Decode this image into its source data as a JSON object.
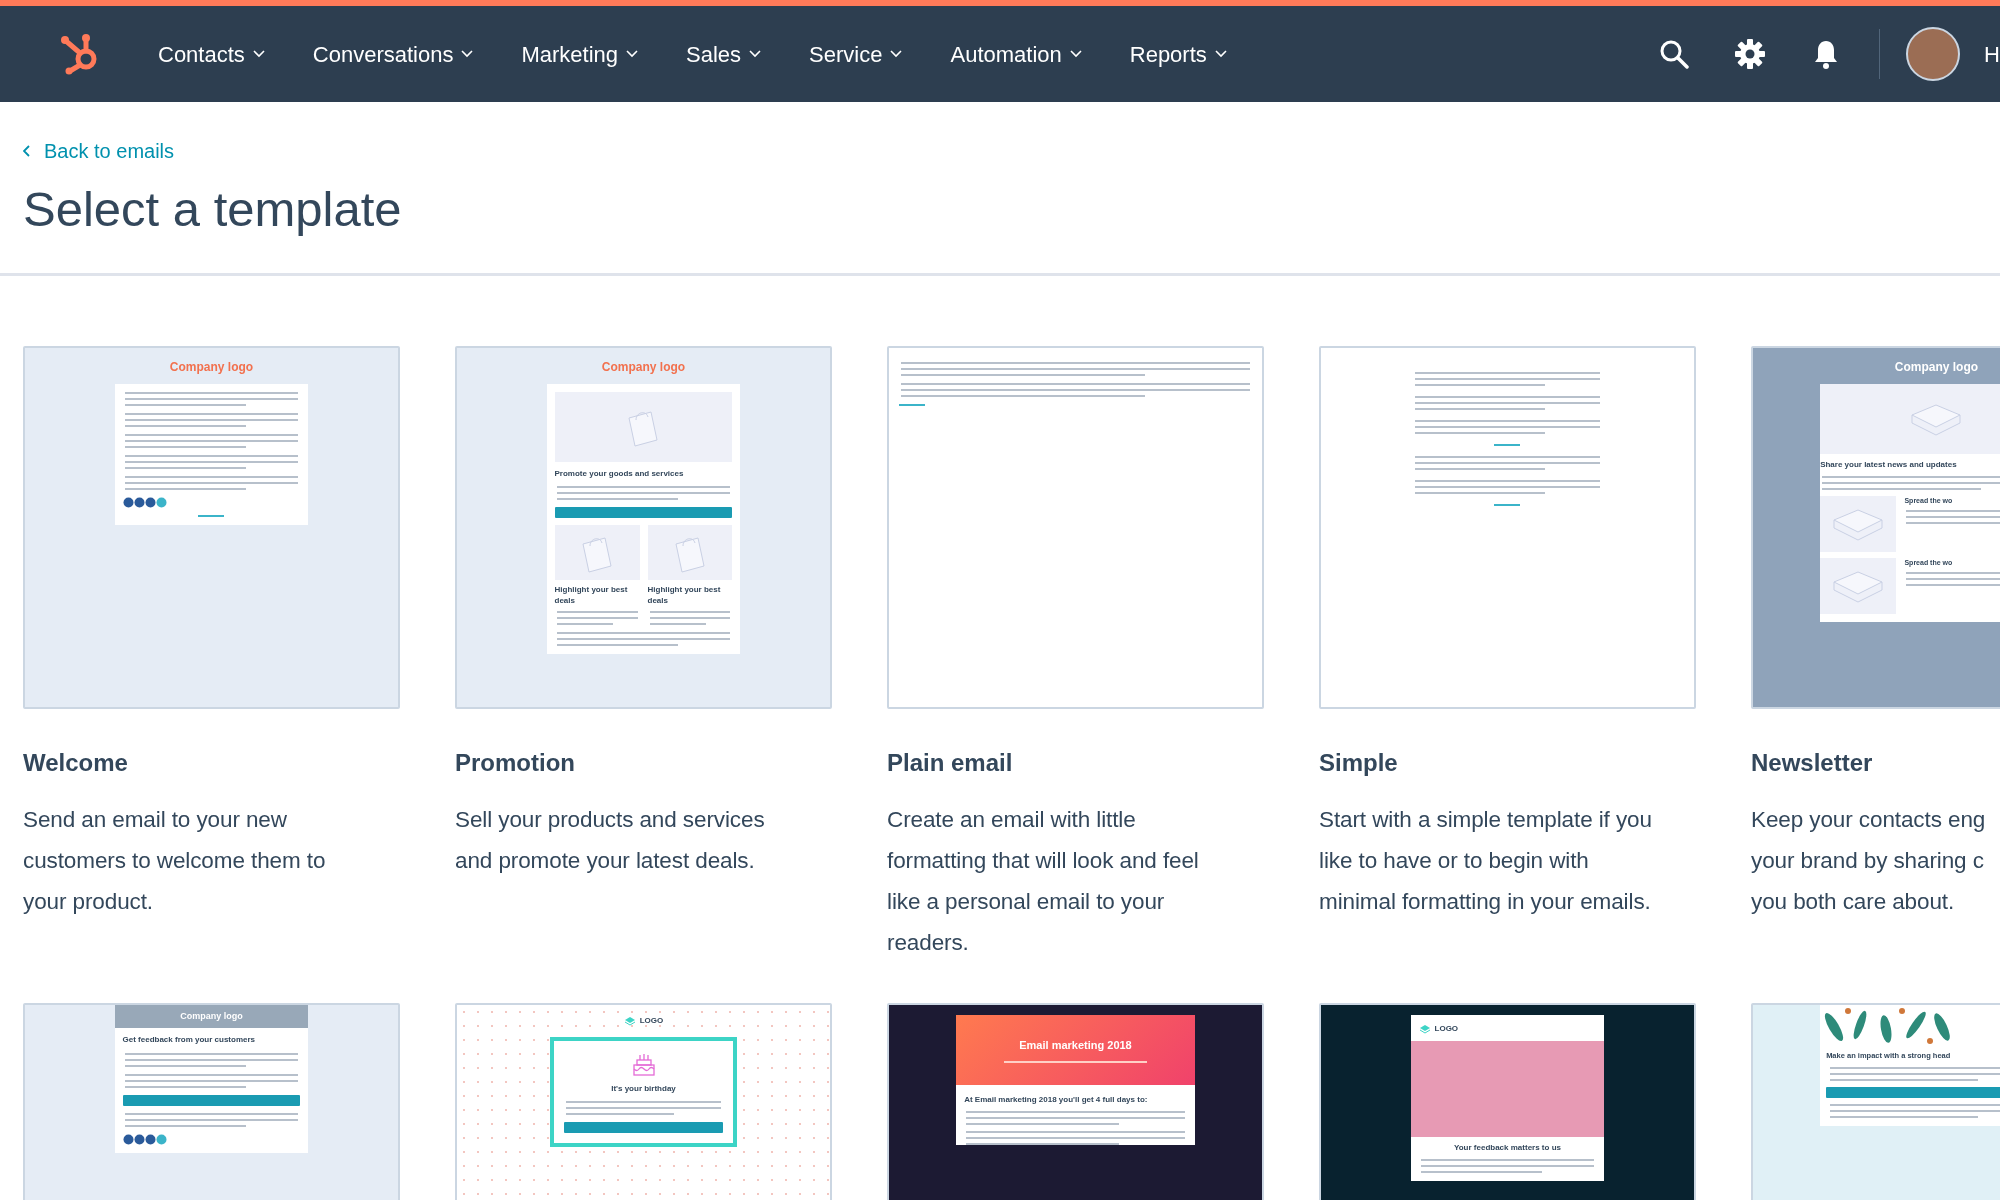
{
  "nav": {
    "items": [
      {
        "label": "Contacts"
      },
      {
        "label": "Conversations"
      },
      {
        "label": "Marketing"
      },
      {
        "label": "Sales"
      },
      {
        "label": "Service"
      },
      {
        "label": "Automation"
      },
      {
        "label": "Reports"
      }
    ],
    "user_name": "H"
  },
  "back_link": "Back to emails",
  "title": "Select a template",
  "templates": [
    {
      "name": "Welcome",
      "description": [
        "Send an email to your new",
        "customers to welcome them to",
        "your product."
      ],
      "preview": {
        "kind": "boxed",
        "logo": {
          "kind": "text",
          "text": "Company logo"
        },
        "blocks": [
          {
            "kind": "lines"
          },
          {
            "kind": "lines"
          },
          {
            "kind": "lines"
          },
          {
            "kind": "lines"
          },
          {
            "kind": "lines"
          },
          {
            "kind": "social"
          },
          {
            "kind": "link"
          }
        ]
      }
    },
    {
      "name": "Promotion",
      "description": [
        "Sell your products and services",
        "and promote your latest deals."
      ],
      "preview": {
        "kind": "boxed",
        "logo": {
          "kind": "text",
          "text": "Company logo"
        },
        "blocks": [
          {
            "kind": "image"
          },
          {
            "kind": "heading",
            "text": "Promote your goods and services"
          },
          {
            "kind": "lines"
          },
          {
            "kind": "cta"
          },
          {
            "kind": "cols",
            "items": [
              {
                "text": "Highlight your best deals"
              },
              {
                "text": "Highlight your best deals"
              }
            ]
          },
          {
            "kind": "lines"
          }
        ]
      }
    },
    {
      "name": "Plain email",
      "description": [
        "Create an email with little",
        "formatting that will look and feel",
        "like a personal email to your",
        "readers."
      ],
      "preview": {
        "kind": "plain",
        "blocks": [
          {
            "kind": "lines"
          },
          {
            "kind": "lines"
          },
          {
            "kind": "link"
          }
        ]
      }
    },
    {
      "name": "Simple",
      "description": [
        "Start with a simple template if you",
        "like to have or to begin with",
        "minimal formatting in your emails."
      ],
      "preview": {
        "kind": "simple",
        "blocks": [
          {
            "kind": "lines"
          },
          {
            "kind": "lines"
          },
          {
            "kind": "lines"
          },
          {
            "kind": "link"
          },
          {
            "kind": "lines"
          },
          {
            "kind": "lines"
          },
          {
            "kind": "link"
          }
        ]
      }
    },
    {
      "name": "Newsletter",
      "description": [
        "Keep your contacts eng",
        "your brand by sharing c",
        "you both care about."
      ],
      "preview": {
        "kind": "slate",
        "logo": {
          "kind": "text",
          "text": "Company logo"
        },
        "blocks": [
          {
            "kind": "image"
          },
          {
            "kind": "heading",
            "text": "Share your latest news and updates"
          },
          {
            "kind": "lines"
          },
          {
            "kind": "side",
            "text": "Spread the wo"
          },
          {
            "kind": "side",
            "text": "Spread the wo"
          }
        ]
      }
    },
    {
      "preview": {
        "kind": "boxed",
        "blocks": [
          {
            "kind": "logobar",
            "text": "Company logo"
          },
          {
            "kind": "heading",
            "text": "Get feedback from your customers"
          },
          {
            "kind": "lines"
          },
          {
            "kind": "lines"
          },
          {
            "kind": "cta"
          },
          {
            "kind": "lines"
          },
          {
            "kind": "social"
          }
        ]
      }
    },
    {
      "preview": {
        "kind": "dots",
        "logo": {
          "kind": "mark",
          "text": "LOGO"
        },
        "blocks": [
          {
            "kind": "cake"
          },
          {
            "kind": "heading",
            "text": "It's your birthday"
          },
          {
            "kind": "lines"
          },
          {
            "kind": "cta"
          }
        ]
      }
    },
    {
      "preview": {
        "kind": "dark",
        "blocks": [
          {
            "kind": "banner",
            "text": "Email marketing 2018"
          },
          {
            "kind": "heading",
            "text": "At Email marketing 2018 you'll get 4 full days to:"
          },
          {
            "kind": "lines"
          },
          {
            "kind": "lines"
          }
        ]
      }
    },
    {
      "preview": {
        "kind": "teal",
        "blocks": [
          {
            "kind": "logomark",
            "text": "LOGO"
          },
          {
            "kind": "photo"
          },
          {
            "kind": "heading",
            "text": "Your feedback matters to us"
          },
          {
            "kind": "lines"
          }
        ]
      }
    },
    {
      "preview": {
        "kind": "sky",
        "blocks": [
          {
            "kind": "leaves"
          },
          {
            "kind": "heading",
            "text": "Make an impact with a strong head"
          },
          {
            "kind": "lines"
          },
          {
            "kind": "cta"
          },
          {
            "kind": "lines"
          }
        ]
      }
    }
  ]
}
